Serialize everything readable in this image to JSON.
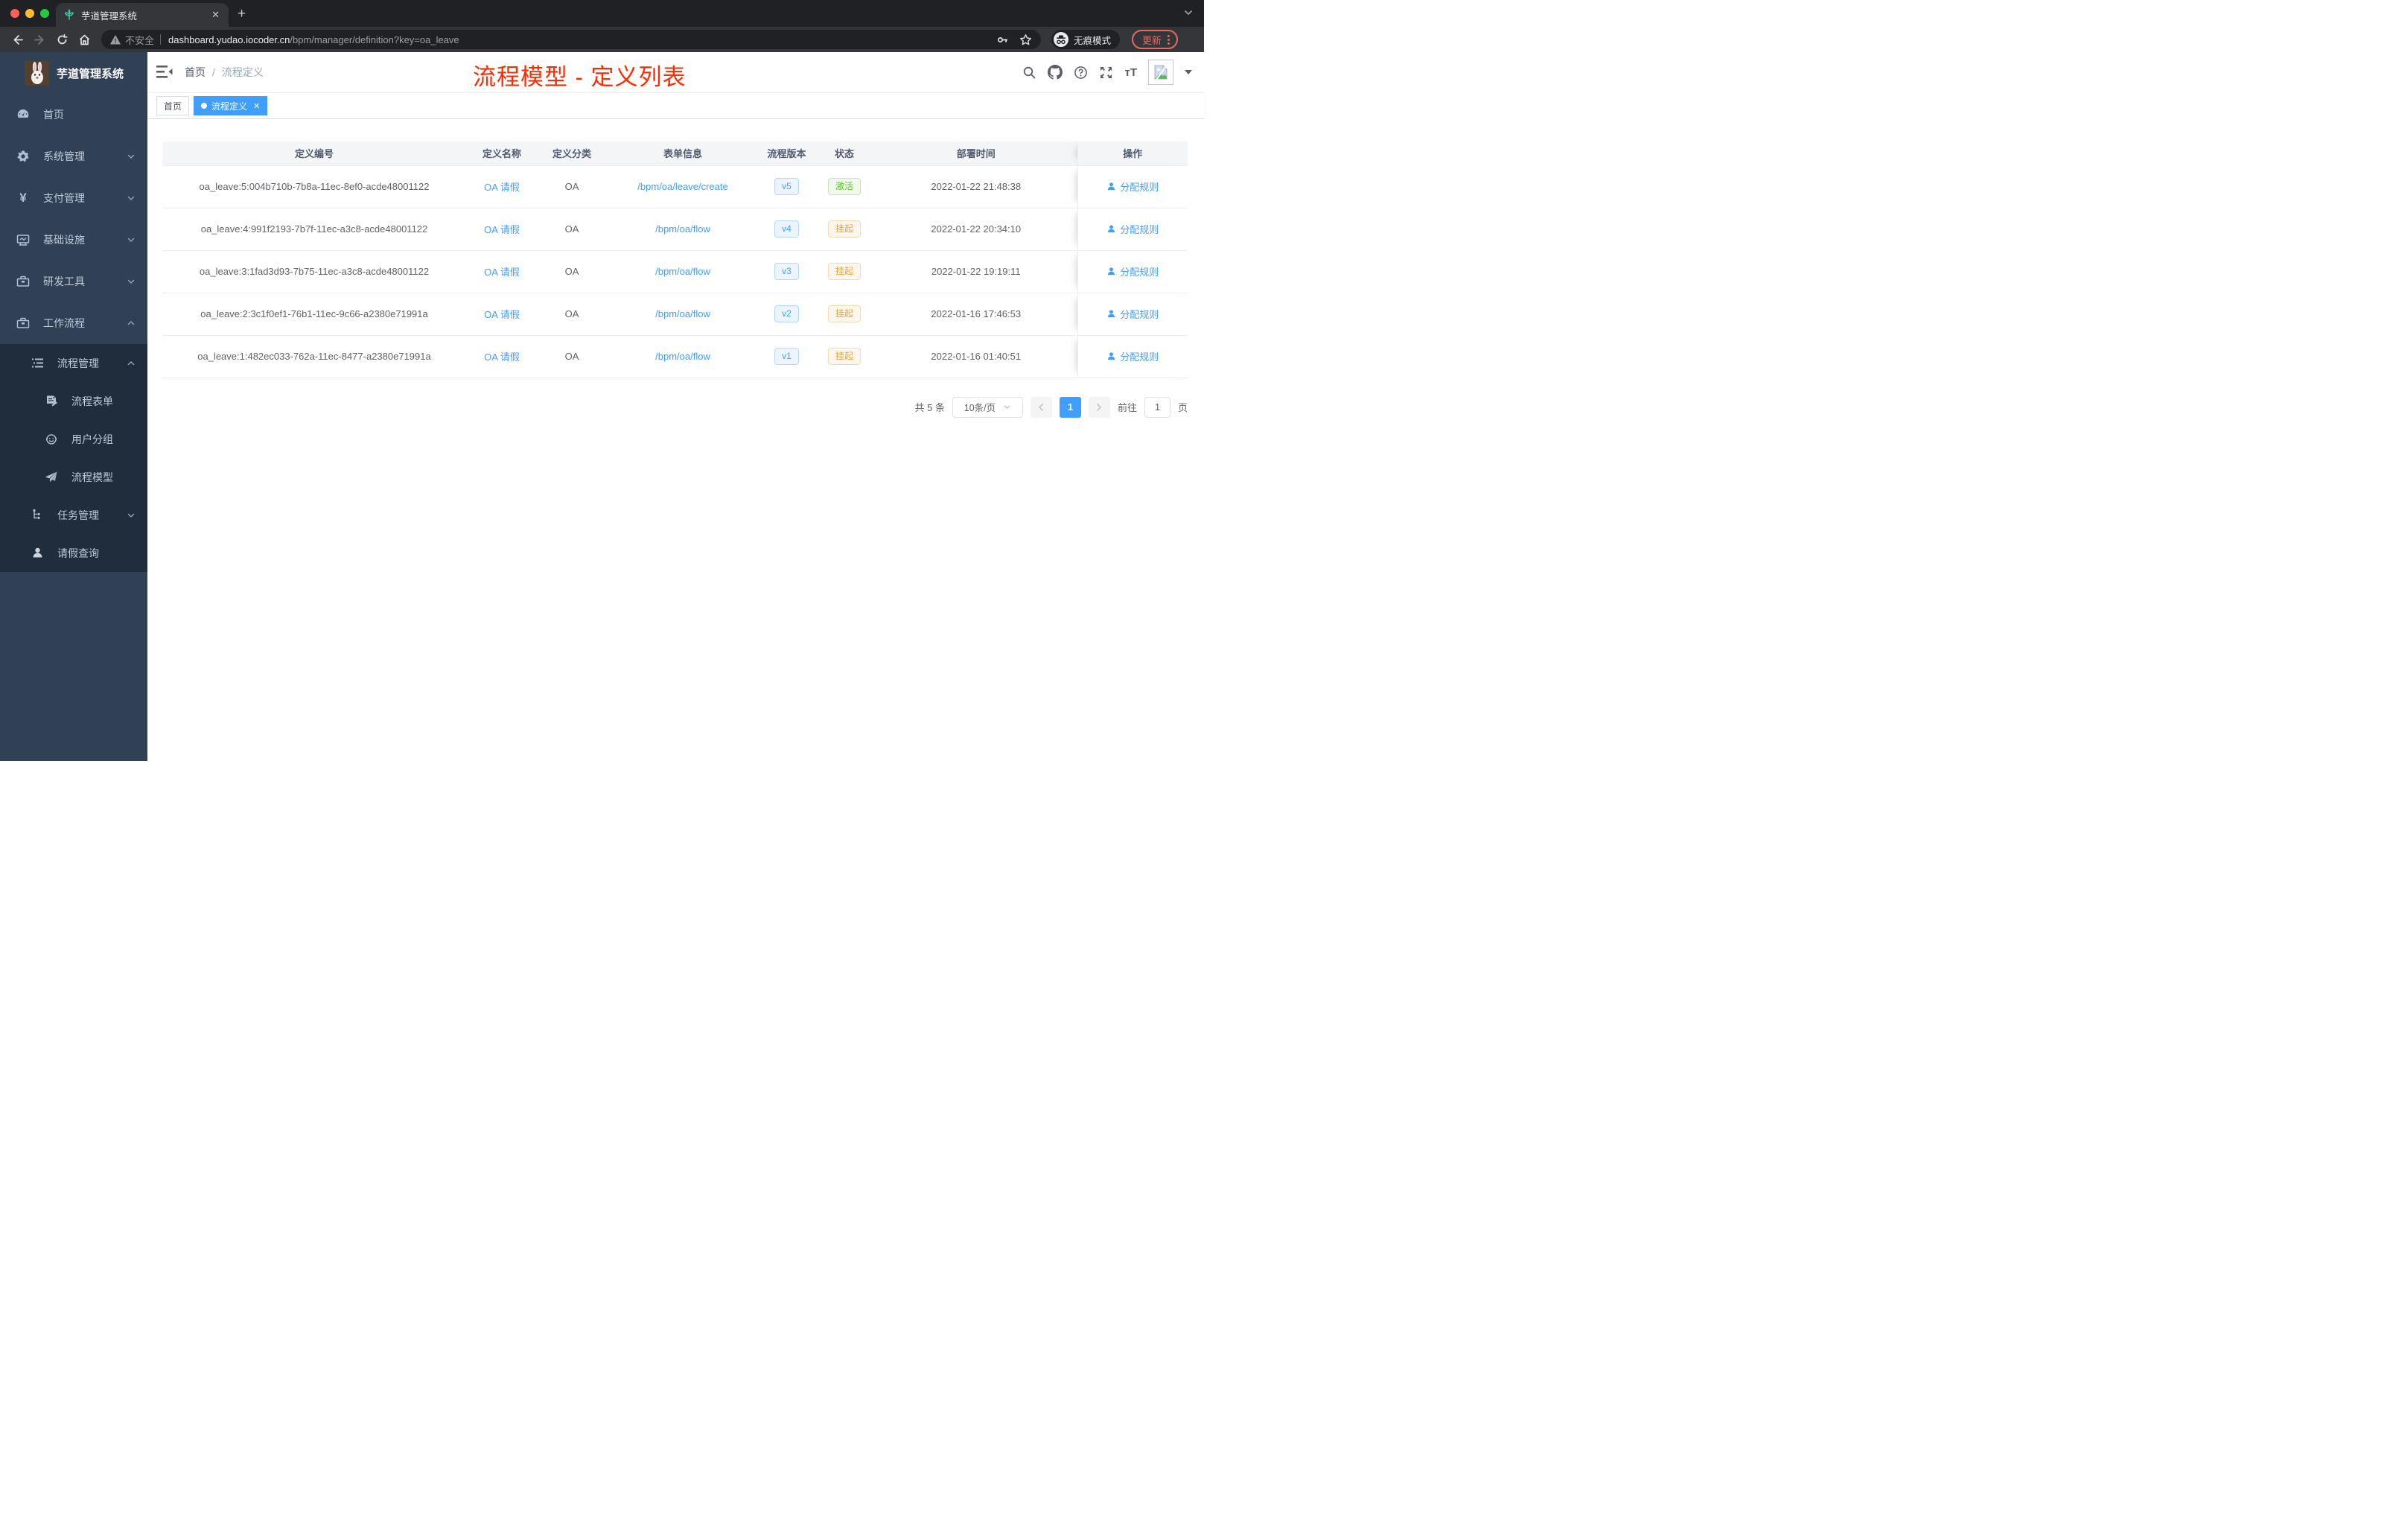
{
  "browser": {
    "tab_title": "芋道管理系统",
    "security_label": "不安全",
    "url_host": "dashboard.yudao.iocoder.cn",
    "url_path": "/bpm/manager/definition?key=oa_leave",
    "incognito_label": "无痕模式",
    "update_label": "更新"
  },
  "sidebar": {
    "logo_title": "芋道管理系统",
    "items": [
      {
        "label": "首页",
        "icon": "dashboard-icon"
      },
      {
        "label": "系统管理",
        "icon": "gear-icon",
        "chevron": "down"
      },
      {
        "label": "支付管理",
        "icon": "yen-icon",
        "chevron": "down"
      },
      {
        "label": "基础设施",
        "icon": "monitor-icon",
        "chevron": "down"
      },
      {
        "label": "研发工具",
        "icon": "toolbox-icon",
        "chevron": "down"
      },
      {
        "label": "工作流程",
        "icon": "briefcase-icon",
        "chevron": "up"
      },
      {
        "label": "流程管理",
        "icon": "list-icon",
        "chevron": "up"
      },
      {
        "label": "流程表单",
        "icon": "form-icon"
      },
      {
        "label": "用户分组",
        "icon": "robot-icon"
      },
      {
        "label": "流程模型",
        "icon": "paper-plane-icon"
      },
      {
        "label": "任务管理",
        "icon": "tree-icon",
        "chevron": "down"
      },
      {
        "label": "请假查询",
        "icon": "user-icon"
      }
    ]
  },
  "header": {
    "breadcrumb_home": "首页",
    "breadcrumb_sep": "/",
    "breadcrumb_current": "流程定义",
    "overlay_title": "流程模型 - 定义列表",
    "overlay_color": "#fe2b00"
  },
  "tags": {
    "home_label": "首页",
    "active_label": "流程定义"
  },
  "table": {
    "columns": [
      "定义编号",
      "定义名称",
      "定义分类",
      "表单信息",
      "流程版本",
      "状态",
      "部署时间",
      "操作"
    ],
    "rows": [
      {
        "id": "oa_leave:5:004b710b-7b8a-11ec-8ef0-acde48001122",
        "name": "OA 请假",
        "category": "OA",
        "form": "/bpm/oa/leave/create",
        "version": "v5",
        "status": "激活",
        "status_type": "success",
        "time": "2022-01-22 21:48:38",
        "action": "分配规则"
      },
      {
        "id": "oa_leave:4:991f2193-7b7f-11ec-a3c8-acde48001122",
        "name": "OA 请假",
        "category": "OA",
        "form": "/bpm/oa/flow",
        "version": "v4",
        "status": "挂起",
        "status_type": "warning",
        "time": "2022-01-22 20:34:10",
        "action": "分配规则"
      },
      {
        "id": "oa_leave:3:1fad3d93-7b75-11ec-a3c8-acde48001122",
        "name": "OA 请假",
        "category": "OA",
        "form": "/bpm/oa/flow",
        "version": "v3",
        "status": "挂起",
        "status_type": "warning",
        "time": "2022-01-22 19:19:11",
        "action": "分配规则"
      },
      {
        "id": "oa_leave:2:3c1f0ef1-76b1-11ec-9c66-a2380e71991a",
        "name": "OA 请假",
        "category": "OA",
        "form": "/bpm/oa/flow",
        "version": "v2",
        "status": "挂起",
        "status_type": "warning",
        "time": "2022-01-16 17:46:53",
        "action": "分配规则"
      },
      {
        "id": "oa_leave:1:482ec033-762a-11ec-8477-a2380e71991a",
        "name": "OA 请假",
        "category": "OA",
        "form": "/bpm/oa/flow",
        "version": "v1",
        "status": "挂起",
        "status_type": "warning",
        "time": "2022-01-16 01:40:51",
        "action": "分配规则"
      }
    ]
  },
  "pagination": {
    "total_label": "共 5 条",
    "page_size_label": "10条/页",
    "current_page": "1",
    "goto_label": "前往",
    "goto_value": "1",
    "page_unit_label": "页"
  },
  "colors": {
    "accent_blue": "#409eff",
    "sidebar_bg": "#304156",
    "submenu_bg": "#1f2d3d",
    "status_active_green": "#67c23a",
    "status_suspend_orange": "#e6a23c",
    "annotation_red": "#fe2b00",
    "update_button_red": "#e06c60"
  }
}
